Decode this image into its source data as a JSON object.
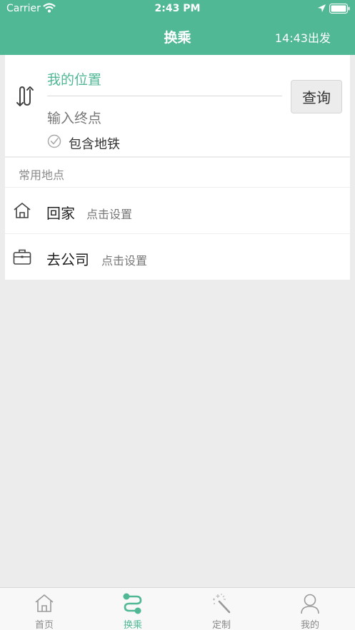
{
  "status_bar": {
    "carrier": "Carrier",
    "time": "2:43 PM"
  },
  "header": {
    "title": "换乘",
    "depart_time": "14:43出发"
  },
  "route": {
    "origin": "我的位置",
    "destination_placeholder": "输入终点",
    "subway_option": "包含地铁",
    "query_button": "查询"
  },
  "places": {
    "heading": "常用地点",
    "items": [
      {
        "name": "回家",
        "hint": "点击设置",
        "icon": "home-icon"
      },
      {
        "name": "去公司",
        "hint": "点击设置",
        "icon": "briefcase-icon"
      }
    ]
  },
  "tabbar": {
    "tabs": [
      {
        "label": "首页",
        "icon": "home-icon",
        "active": false
      },
      {
        "label": "换乘",
        "icon": "route-icon",
        "active": true
      },
      {
        "label": "定制",
        "icon": "magic-wand-icon",
        "active": false
      },
      {
        "label": "我的",
        "icon": "user-icon",
        "active": false
      }
    ]
  },
  "colors": {
    "brand": "#50b894",
    "background": "#ececec"
  }
}
